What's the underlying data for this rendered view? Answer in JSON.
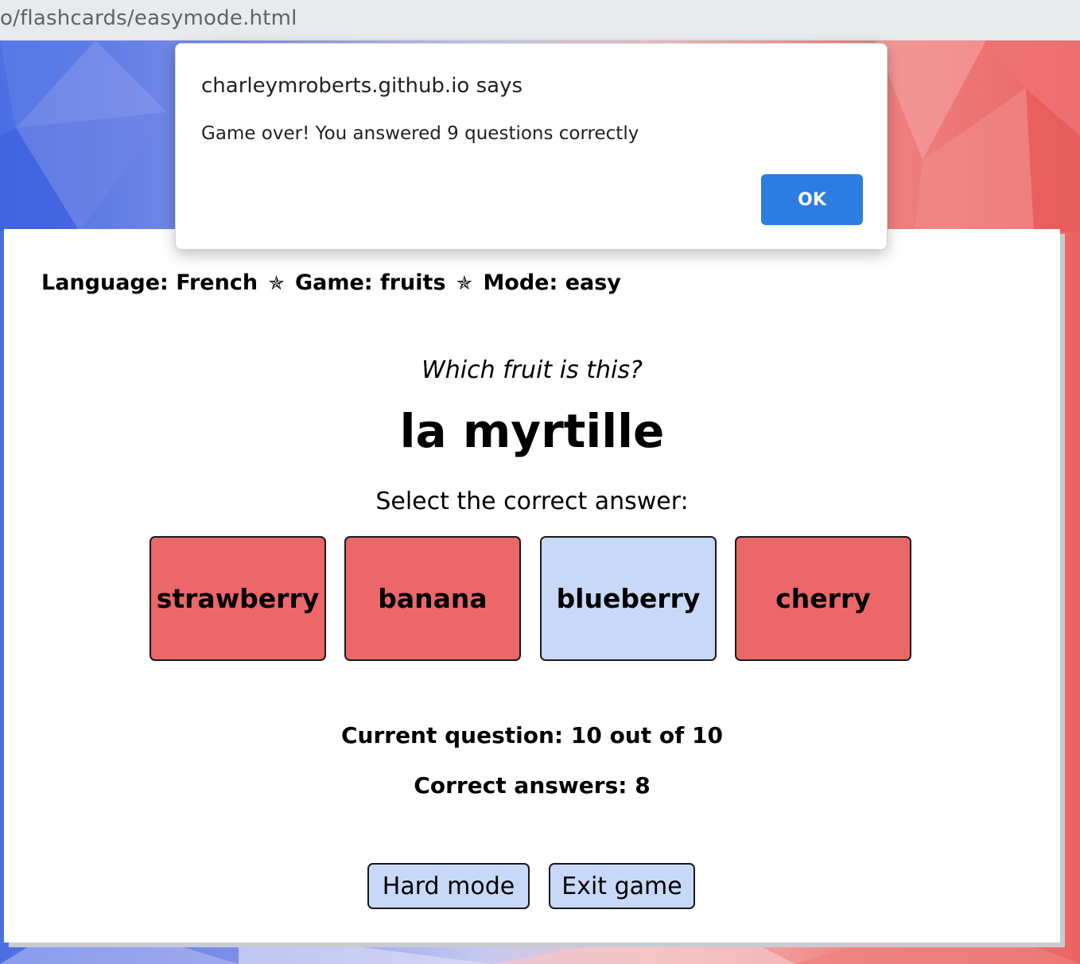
{
  "browser": {
    "url_prefix": "o",
    "url_path": "/flashcards/easymode.html"
  },
  "header": {
    "language_label": "Language: French",
    "game_label": "Game: fruits",
    "mode_label": "Mode: easy",
    "separator": "✯"
  },
  "question": {
    "prompt": "Which fruit is this?",
    "word": "la myrtille",
    "instruction": "Select the correct answer:"
  },
  "answers": [
    {
      "label": "strawberry",
      "state": "wrong"
    },
    {
      "label": "banana",
      "state": "wrong"
    },
    {
      "label": "blueberry",
      "state": "correct"
    },
    {
      "label": "cherry",
      "state": "wrong"
    }
  ],
  "stats": {
    "current_question": "Current question: 10 out of 10",
    "correct_answers": "Correct answers: 8"
  },
  "buttons": {
    "hard_mode": "Hard mode",
    "exit_game": "Exit game"
  },
  "dialog": {
    "origin": "charleymroberts.github.io says",
    "message": "Game over! You answered 9 questions correctly",
    "ok_label": "OK"
  },
  "colors": {
    "wrong": "#eb676a",
    "correct": "#c8d9f8",
    "ok_button": "#2b7de1"
  }
}
